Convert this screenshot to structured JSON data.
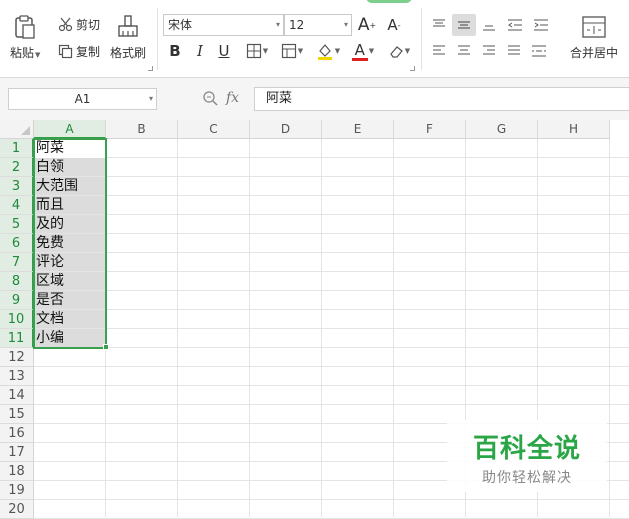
{
  "ribbon": {
    "paste_label": "粘贴",
    "cut_label": "剪切",
    "copy_label": "复制",
    "format_painter_label": "格式刷",
    "font_name": "宋体",
    "font_size": "12",
    "merge_center_label": "合并居中"
  },
  "formula_bar": {
    "name_box": "A1",
    "fx_label": "fx",
    "content": "阿菜"
  },
  "sheet": {
    "columns": [
      "A",
      "B",
      "C",
      "D",
      "E",
      "F",
      "G",
      "H"
    ],
    "rows": [
      "1",
      "2",
      "3",
      "4",
      "5",
      "6",
      "7",
      "8",
      "9",
      "10",
      "11",
      "12",
      "13",
      "14",
      "15",
      "16",
      "17",
      "18",
      "19",
      "20"
    ],
    "column_a_values": [
      "阿菜",
      "白领",
      "大范围",
      "而且",
      "及的",
      "免费",
      "评论",
      "区域",
      "是否",
      "文档",
      "小编"
    ],
    "selection": "A1:A11"
  },
  "watermark": {
    "title": "百科全说",
    "subtitle": "助你轻松解决"
  },
  "colors": {
    "accent_green": "#3aa04d",
    "watermark_green": "#2aa646"
  }
}
